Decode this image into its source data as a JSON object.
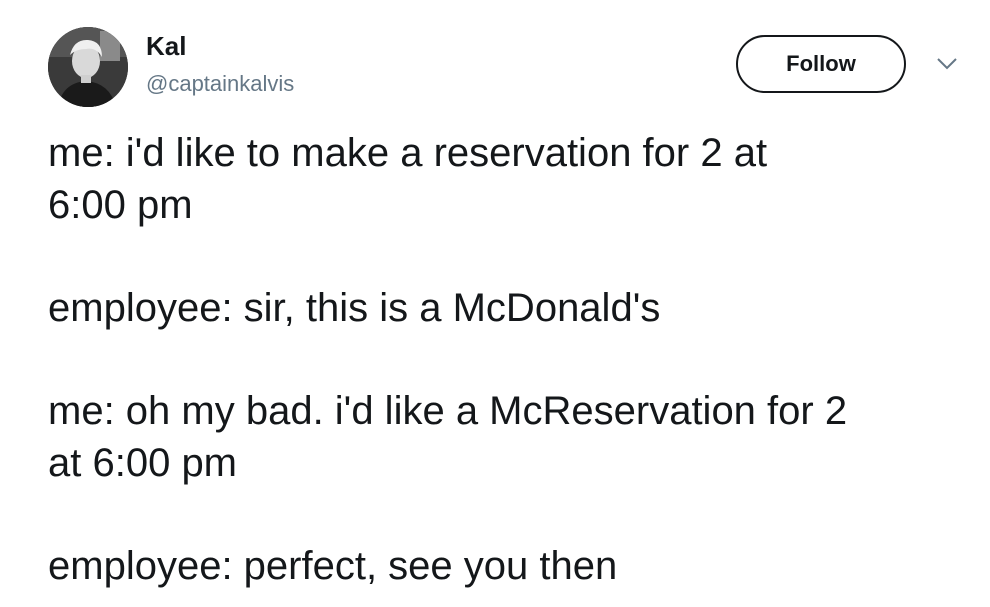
{
  "author": {
    "display_name": "Kal",
    "handle": "@captainkalvis"
  },
  "actions": {
    "follow_label": "Follow",
    "menu_icon": "chevron-down-icon"
  },
  "tweet": {
    "paragraphs": [
      [
        "me: i'd like to make a reservation for 2 at",
        "6:00 pm"
      ],
      [
        "employee: sir, this is a McDonald's"
      ],
      [
        "me: oh my bad. i'd like a McReservation for 2",
        "at 6:00 pm"
      ],
      [
        "employee: perfect, see you then"
      ]
    ]
  },
  "colors": {
    "text": "#14171a",
    "secondary": "#657786",
    "background": "#ffffff"
  }
}
